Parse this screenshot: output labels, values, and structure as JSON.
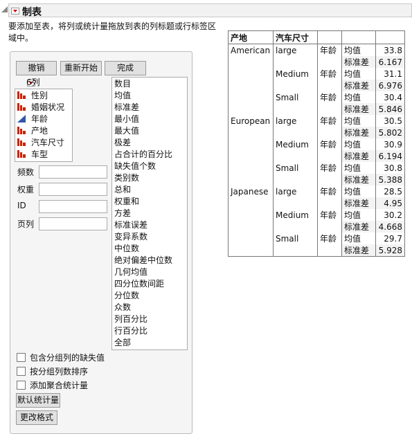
{
  "title": "制表",
  "instruction": "要添加至表，将列或统计量拖放到表的列标题或行标签区域中。",
  "instruction_line1": "要添加至表，将列或统计量拖放到表的列标题或行标签区",
  "instruction_line2": "域中。",
  "buttons": {
    "undo": "撤销",
    "restart": "重新开始",
    "done": "完成",
    "default_stats": "默认统计量",
    "change_format": "更改格式"
  },
  "columns_header": "6列",
  "columns": [
    {
      "name": "性别",
      "type": "nominal"
    },
    {
      "name": "婚姻状况",
      "type": "nominal"
    },
    {
      "name": "年龄",
      "type": "continuous"
    },
    {
      "name": "产地",
      "type": "nominal"
    },
    {
      "name": "汽车尺寸",
      "type": "nominal"
    },
    {
      "name": "车型",
      "type": "nominal"
    }
  ],
  "stats": [
    "数目",
    "均值",
    "标准差",
    "最小值",
    "最大值",
    "极差",
    "占合计的百分比",
    "缺失值个数",
    "类别数",
    "总和",
    "权重和",
    "方差",
    "标准误差",
    "变异系数",
    "中位数",
    "绝对偏差中位数",
    "几何均值",
    "四分位数间距",
    "分位数",
    "众数",
    "列百分比",
    "行百分比",
    "全部"
  ],
  "fields": {
    "freq": "频数",
    "weight": "权重",
    "id": "ID",
    "page": "页列"
  },
  "checkboxes": [
    {
      "label": "包含分组列的缺失值",
      "checked": false
    },
    {
      "label": "按分组列数排序",
      "checked": false
    },
    {
      "label": "添加聚合统计量",
      "checked": false
    }
  ],
  "table": {
    "headers": [
      "产地",
      "汽车尺寸",
      "",
      "",
      ""
    ],
    "rows": [
      [
        "American",
        "large",
        "年龄",
        "均值",
        "33.8"
      ],
      [
        "",
        "",
        "",
        "标准差",
        "6.167"
      ],
      [
        "",
        "Medium",
        "年龄",
        "均值",
        "31.1"
      ],
      [
        "",
        "",
        "",
        "标准差",
        "6.976"
      ],
      [
        "",
        "Small",
        "年龄",
        "均值",
        "30.4"
      ],
      [
        "",
        "",
        "",
        "标准差",
        "5.846"
      ],
      [
        "European",
        "large",
        "年龄",
        "均值",
        "30.5"
      ],
      [
        "",
        "",
        "",
        "标准差",
        "5.802"
      ],
      [
        "",
        "Medium",
        "年龄",
        "均值",
        "30.9"
      ],
      [
        "",
        "",
        "",
        "标准差",
        "6.194"
      ],
      [
        "",
        "Small",
        "年龄",
        "均值",
        "30.8"
      ],
      [
        "",
        "",
        "",
        "标准差",
        "5.388"
      ],
      [
        "Japanese",
        "large",
        "年龄",
        "均值",
        "28.5"
      ],
      [
        "",
        "",
        "",
        "标准差",
        "4.95"
      ],
      [
        "",
        "Medium",
        "年龄",
        "均值",
        "30.2"
      ],
      [
        "",
        "",
        "",
        "标准差",
        "4.668"
      ],
      [
        "",
        "Small",
        "年龄",
        "均值",
        "29.7"
      ],
      [
        "",
        "",
        "",
        "标准差",
        "5.928"
      ]
    ]
  },
  "colors": {
    "nominal_icon": "#cc2200",
    "continuous_icon": "#3355aa"
  }
}
